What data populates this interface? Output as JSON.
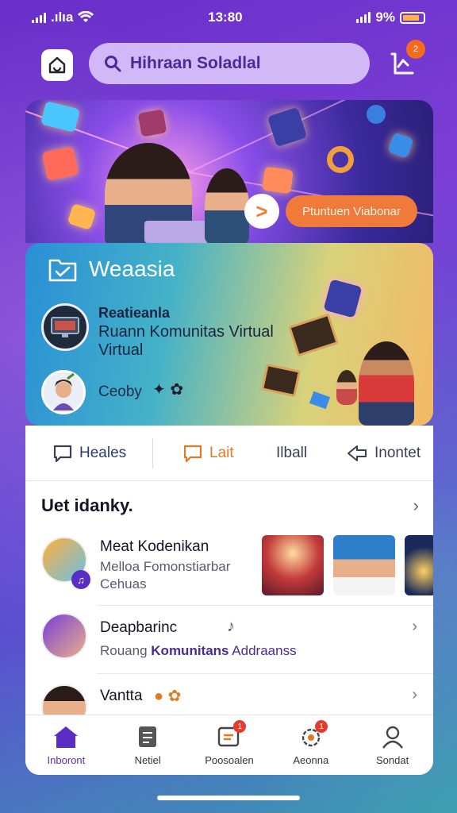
{
  "status_bar": {
    "carrier": ".ılıa",
    "time": "13:80",
    "battery": "9%"
  },
  "header": {
    "search_value": "Hihraan Soladlal",
    "notification_count": "2"
  },
  "banner": {
    "cta_label": "Ptuntuen Viabonar"
  },
  "community": {
    "title": "Weaasia",
    "feature_line1": "Reatieanla",
    "feature_line2": "Ruann Komunitas Virtual Virtual",
    "user_name": "Ceoby"
  },
  "tabs": [
    {
      "label": "Heales"
    },
    {
      "label": "Lait"
    },
    {
      "label": "Ilball"
    },
    {
      "label": "Inontet"
    }
  ],
  "section": {
    "title": "Uet idanky."
  },
  "list": [
    {
      "title": "Meat Kodenikan",
      "sub1": "Melloa Fomonstiarbar",
      "sub2": "Cehuas"
    },
    {
      "title": "Deapbarinc",
      "sub_plain": "Rouang ",
      "sub_strong": "Komunitans",
      "sub_tail": " Addraanss"
    },
    {
      "title": "Vantta"
    }
  ],
  "bottom_nav": [
    {
      "label": "Inboront",
      "icon": "home-icon",
      "active": true
    },
    {
      "label": "Netiel",
      "icon": "document-icon"
    },
    {
      "label": "Poosoalen",
      "icon": "chat-icon",
      "badge": "1"
    },
    {
      "label": "Aeonna",
      "icon": "settings-icon",
      "badge": "1"
    },
    {
      "label": "Sondat",
      "icon": "user-icon"
    }
  ],
  "colors": {
    "brand_purple": "#5a2dc4",
    "accent_orange": "#f07a3a",
    "badge_red": "#e63b2e"
  }
}
